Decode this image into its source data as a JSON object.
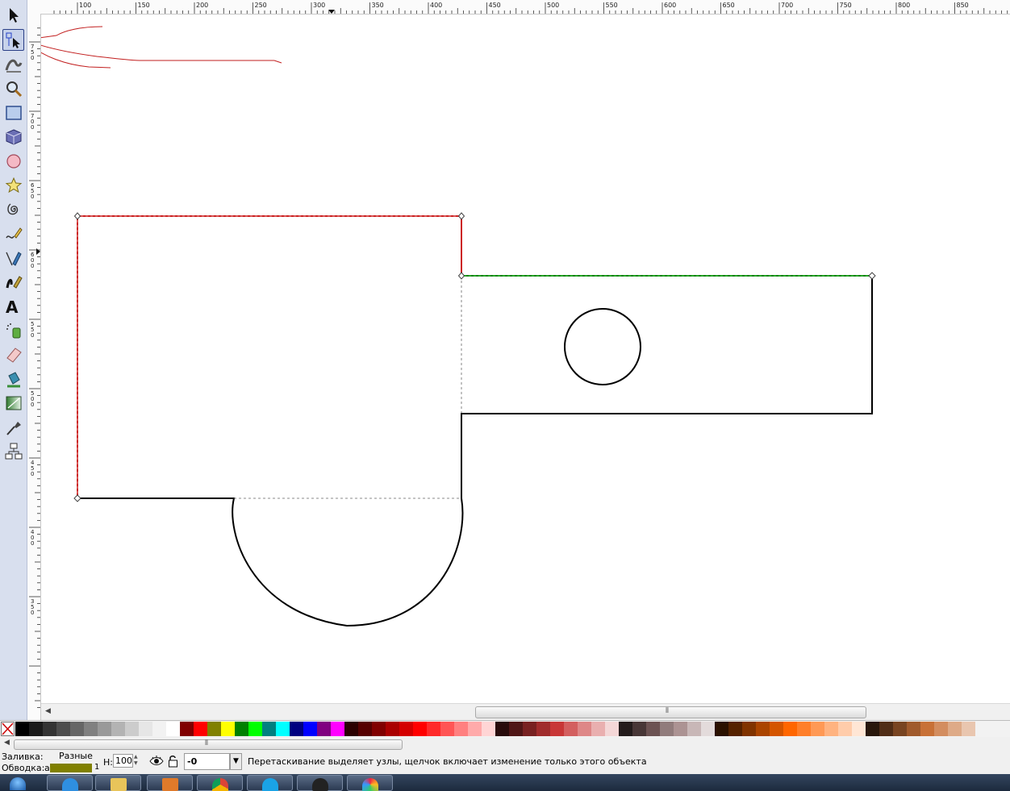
{
  "toolbox": {
    "tools": [
      {
        "name": "selector-tool",
        "active": false
      },
      {
        "name": "node-tool",
        "active": true
      },
      {
        "name": "tweak-tool",
        "active": false
      },
      {
        "name": "zoom-tool",
        "active": false
      },
      {
        "name": "rectangle-tool",
        "active": false
      },
      {
        "name": "3d-box-tool",
        "active": false
      },
      {
        "name": "ellipse-tool",
        "active": false
      },
      {
        "name": "star-tool",
        "active": false
      },
      {
        "name": "spiral-tool",
        "active": false
      },
      {
        "name": "pencil-tool",
        "active": false
      },
      {
        "name": "pen-tool",
        "active": false
      },
      {
        "name": "calligraphy-tool",
        "active": false
      },
      {
        "name": "text-tool",
        "active": false
      },
      {
        "name": "spray-tool",
        "active": false
      },
      {
        "name": "eraser-tool",
        "active": false
      },
      {
        "name": "paint-bucket-tool",
        "active": false
      },
      {
        "name": "gradient-tool",
        "active": false
      },
      {
        "name": "dropper-tool",
        "active": false
      },
      {
        "name": "connector-tool",
        "active": false
      }
    ]
  },
  "ruler": {
    "horizontal_labels": [
      "100",
      "150",
      "200",
      "250",
      "300",
      "350",
      "400",
      "450",
      "500",
      "550",
      "600",
      "650",
      "700",
      "750",
      "800",
      "850"
    ],
    "vertical_labels": [
      "750",
      "700",
      "650",
      "600",
      "550",
      "500",
      "450",
      "400",
      "350"
    ]
  },
  "palette": {
    "none_swatch": "none-color",
    "colors": [
      "#000000",
      "#1a1a1a",
      "#333333",
      "#4d4d4d",
      "#666666",
      "#808080",
      "#999999",
      "#b3b3b3",
      "#cccccc",
      "#e6e6e6",
      "#f2f2f2",
      "#ffffff",
      "#800000",
      "#ff0000",
      "#808000",
      "#ffff00",
      "#008000",
      "#00ff00",
      "#008080",
      "#00ffff",
      "#000080",
      "#0000ff",
      "#800080",
      "#ff00ff",
      "#2b0000",
      "#550000",
      "#800000",
      "#aa0000",
      "#d40000",
      "#ff0000",
      "#ff2a2a",
      "#ff5555",
      "#ff8080",
      "#ffaaaa",
      "#ffd5d5",
      "#280b0b",
      "#501616",
      "#782121",
      "#a02c2c",
      "#c83737",
      "#d35f5f",
      "#de8787",
      "#e9afaf",
      "#f4d7d7",
      "#241c1c",
      "#483737",
      "#6c5353",
      "#917c7c",
      "#ac9393",
      "#c8b7b7",
      "#e3dbdb",
      "#2b1100",
      "#552200",
      "#803300",
      "#aa4400",
      "#d45500",
      "#ff6600",
      "#ff7f2a",
      "#ff9955",
      "#ffb380",
      "#ffccaa",
      "#ffe6d5",
      "#28170b",
      "#502d16",
      "#784421",
      "#a05a2c",
      "#c87137",
      "#d38d5f",
      "#deaa87",
      "#e9c6af"
    ]
  },
  "status": {
    "fill_label": "Заливка:",
    "fill_value": "Разные",
    "stroke_label": "Обводка:",
    "stroke_value": "а",
    "stroke_color": "#808000",
    "stroke_width": "1",
    "opacity_label": "Н:",
    "opacity_value": "100",
    "layer_value": "-0",
    "message": "Перетаскивание выделяет узлы, щелчок включает изменение только этого объекта"
  },
  "taskbar": {
    "items": [
      "start-orb",
      "internet-explorer",
      "file-explorer",
      "media-player",
      "chrome",
      "skype",
      "inkscape-app",
      "paint-app"
    ]
  }
}
